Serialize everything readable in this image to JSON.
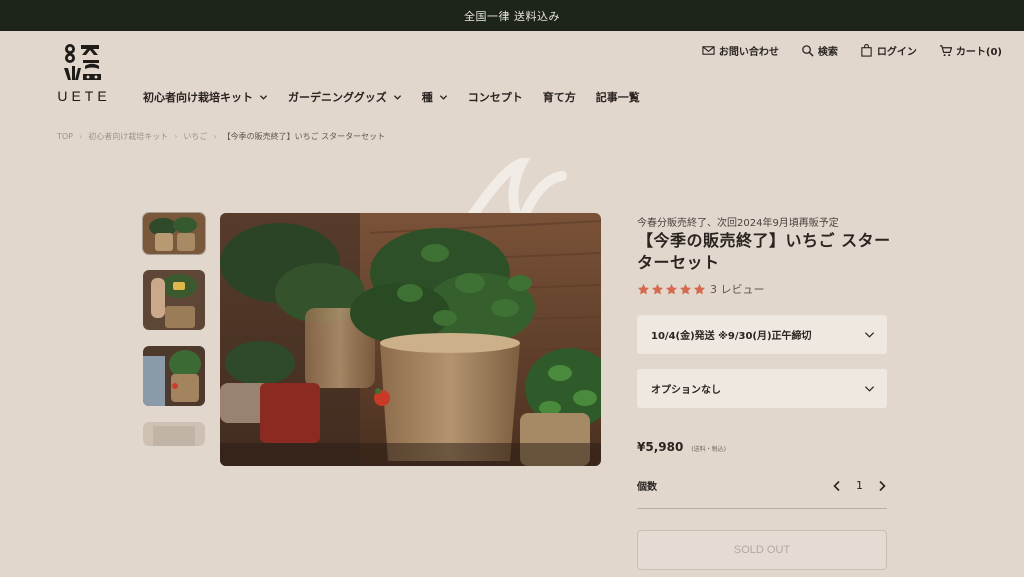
{
  "announcement": "全国一律 送料込み",
  "logo": {
    "text": "UETE"
  },
  "util": {
    "contact": "お問い合わせ",
    "search": "検索",
    "login": "ログイン",
    "cart": "カート(0)"
  },
  "nav": [
    {
      "label": "初心者向け栽培キット",
      "dropdown": true
    },
    {
      "label": "ガーデニンググッズ",
      "dropdown": true
    },
    {
      "label": "種",
      "dropdown": true
    },
    {
      "label": "コンセプト",
      "dropdown": false
    },
    {
      "label": "育て方",
      "dropdown": false
    },
    {
      "label": "記事一覧",
      "dropdown": false
    }
  ],
  "breadcrumb": {
    "home": "TOP",
    "category": "初心者向け栽培キット",
    "subcategory": "いちご",
    "current": "【今季の販売終了】いちご スターターセット"
  },
  "product": {
    "notice": "今春分販売終了、次回2024年9月頃再販予定",
    "title": "【今季の販売終了】いちご スターターセット",
    "rating": 5,
    "reviews": "3 レビュー",
    "shipping_select": "10/4(金)発送 ※9/30(月)正午締切",
    "option_select": "オプションなし",
    "price": "¥5,980",
    "price_note": "(送料・税込)",
    "qty_label": "個数",
    "qty": "1",
    "soldout_label": "SOLD OUT"
  },
  "colors": {
    "background": "#e1d7cd",
    "announce_bar": "#1d2419",
    "star": "#d66a4e"
  }
}
